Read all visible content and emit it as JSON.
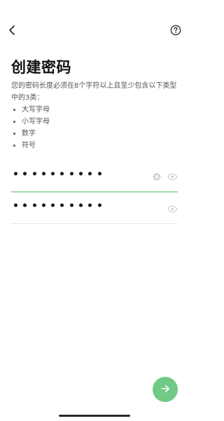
{
  "header": {
    "back_icon": "chevron-left-icon",
    "help_icon": "question-circle-icon"
  },
  "main": {
    "title": "创建密码",
    "description": "您的密码长度必须在8个字符以上且至少包含以下类型中的3类：",
    "requirements": [
      "大写字母",
      "小写字母",
      "数字",
      "符号"
    ]
  },
  "password_field": {
    "masked_length": 10,
    "clear_icon": "clear-icon",
    "visibility_icon": "eye-icon"
  },
  "confirm_password_field": {
    "masked_length": 10,
    "visibility_icon": "eye-icon"
  },
  "next_button": {
    "icon": "arrow-right-icon",
    "color": "#70c984"
  },
  "colors": {
    "accent": "#57be6a",
    "text": "#111111",
    "secondary_text": "#555555"
  }
}
